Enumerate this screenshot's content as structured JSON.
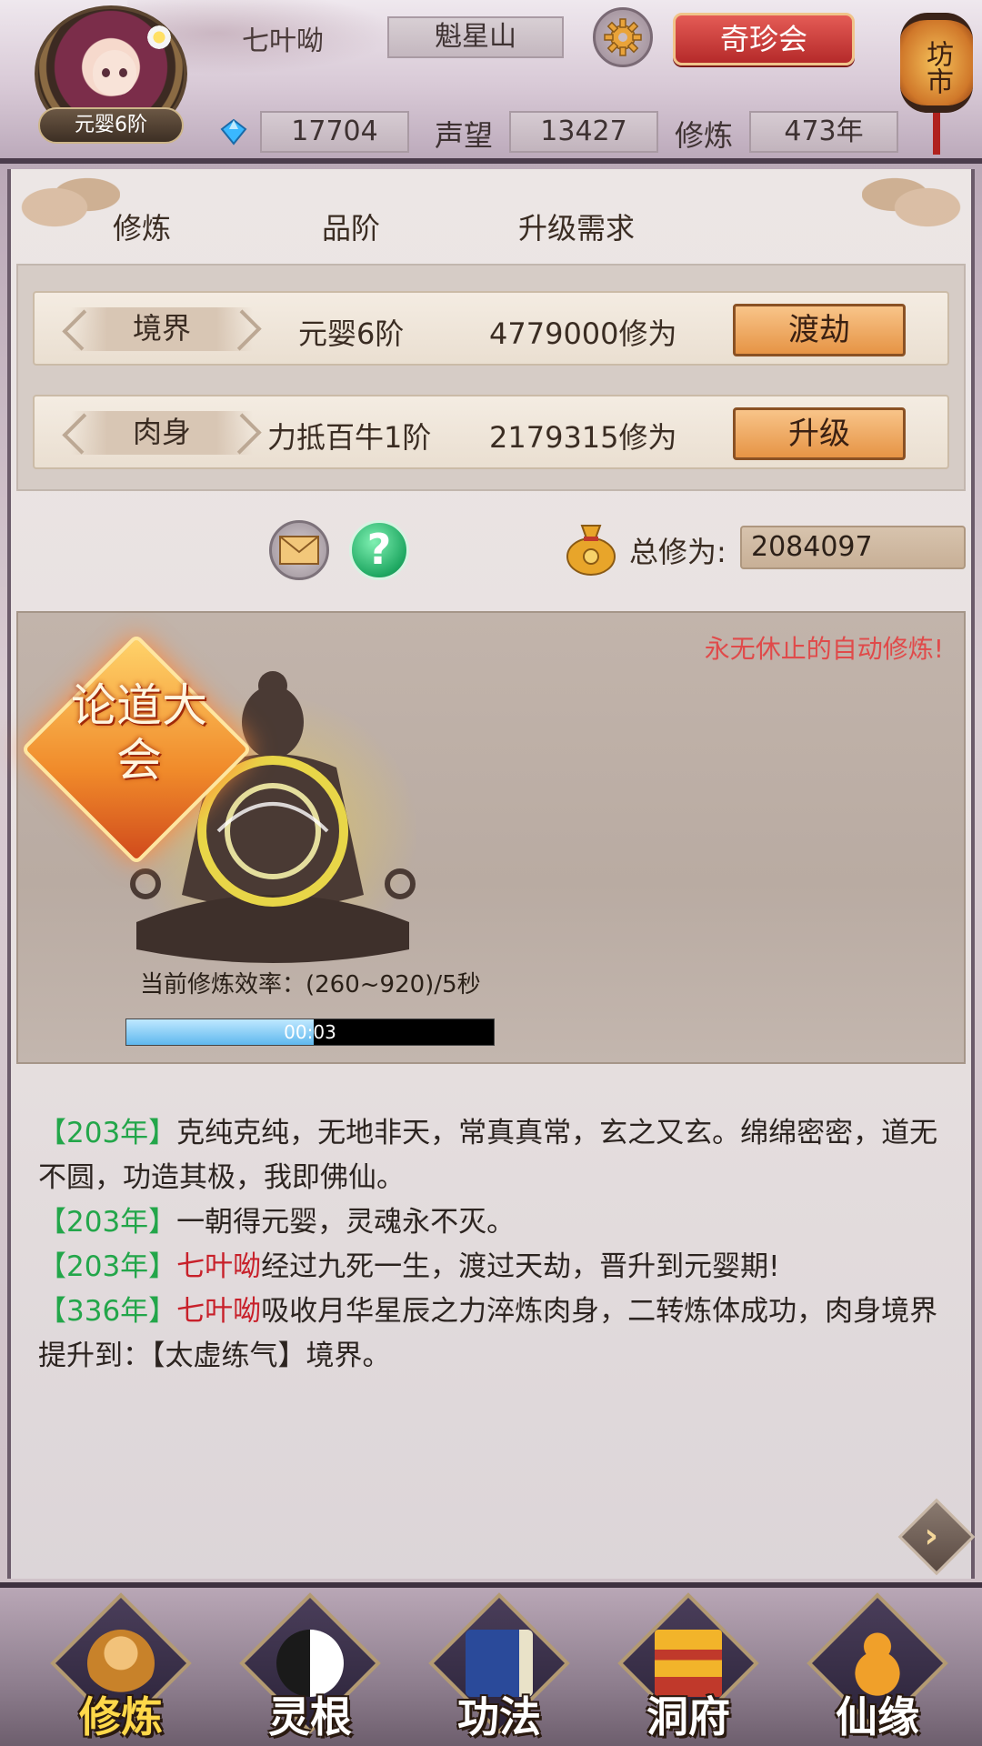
{
  "header": {
    "rank_badge": "元婴6阶",
    "player_name": "七叶呦",
    "location": "魁星山",
    "treasure_button": "奇珍会",
    "lantern_label": "坊市",
    "gems": "17704",
    "reputation_label": "声望",
    "reputation": "13427",
    "cultivation_label": "修炼",
    "cultivation_years": "473年"
  },
  "table": {
    "headers": [
      "修炼",
      "品阶",
      "升级需求"
    ],
    "rows": [
      {
        "tag": "境界",
        "grade": "元婴6阶",
        "requirement": "4779000修为",
        "button": "渡劫"
      },
      {
        "tag": "肉身",
        "grade": "力抵百牛1阶",
        "requirement": "2179315修为",
        "button": "升级"
      }
    ]
  },
  "total": {
    "label": "总修为:",
    "value": "2084097"
  },
  "cultivation": {
    "auto_text": "永无休止的自动修炼!",
    "event_badge": "论道大会",
    "efficiency": "当前修炼效率：(260~920)/5秒",
    "progress_fraction": 0.51,
    "progress_text": "00:03"
  },
  "log": [
    {
      "year": "【203年】",
      "name": "",
      "text": "克纯克纯，无地非天，常真真常，玄之又玄。绵绵密密，道无不圆，功造其极，我即佛仙。"
    },
    {
      "year": "【203年】",
      "name": "",
      "text": "一朝得元婴，灵魂永不灭。"
    },
    {
      "year": "【203年】",
      "name": "七叶呦",
      "text": "经过九死一生，渡过天劫，晋升到元婴期!"
    },
    {
      "year": "【336年】",
      "name": "七叶呦",
      "text": "吸收月华星辰之力淬炼肉身，二转炼体成功，肉身境界提升到：【太虚练气】境界。"
    }
  ],
  "nav": [
    {
      "label": "修炼",
      "icon": "monk-icon",
      "active": true
    },
    {
      "label": "灵根",
      "icon": "yin-yang-sword-icon",
      "active": false
    },
    {
      "label": "功法",
      "icon": "book-icon",
      "active": false
    },
    {
      "label": "洞府",
      "icon": "pagoda-icon",
      "active": false
    },
    {
      "label": "仙缘",
      "icon": "gourd-icon",
      "active": false
    }
  ],
  "colors": {
    "year_green": "#23a64a",
    "name_red": "#c8202a",
    "auto_red": "#e04a4a",
    "button_orange": "#e69445",
    "treasure_red": "#b52a2a"
  }
}
